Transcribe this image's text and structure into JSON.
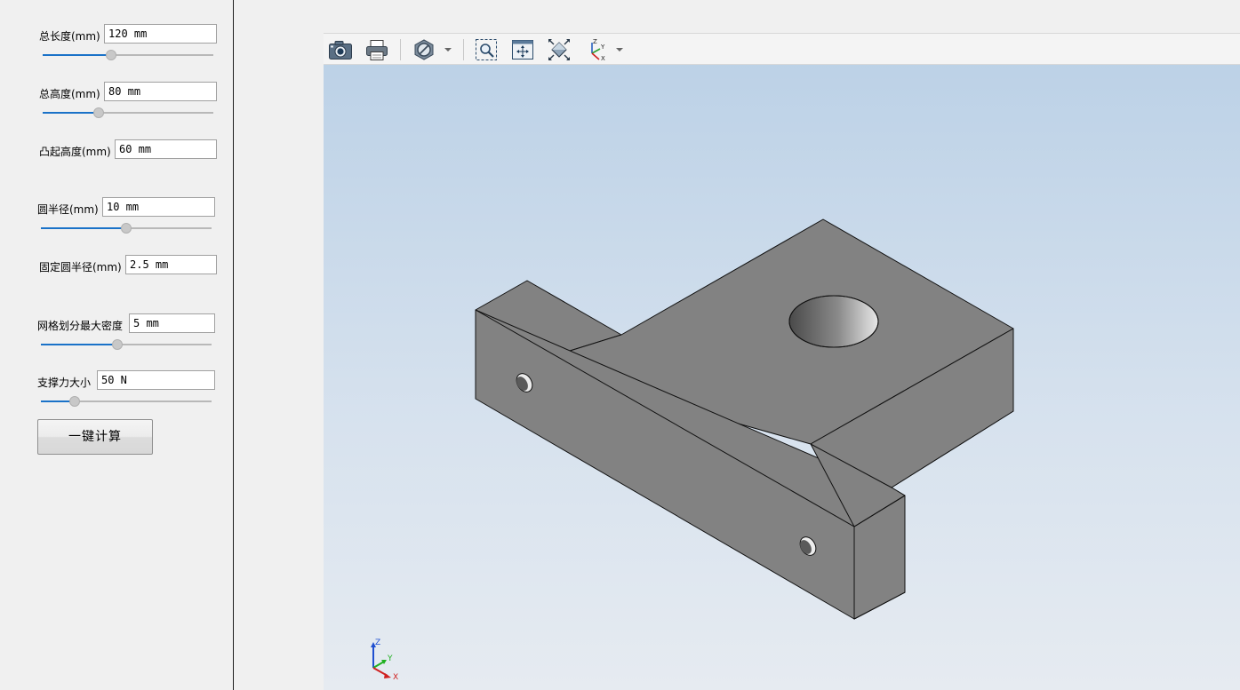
{
  "params": [
    {
      "label": "总长度(mm)",
      "value": "120 mm",
      "slider": 0.4
    },
    {
      "label": "总高度(mm)",
      "value": "80 mm",
      "slider": 0.33
    },
    {
      "label": "凸起高度(mm)",
      "value": "60 mm"
    },
    {
      "label": "圆半径(mm)",
      "value": "10 mm",
      "slider": 0.5
    },
    {
      "label": "固定圆半径(mm)",
      "value": "2.5 mm"
    },
    {
      "label": "网格划分最大密度",
      "value": "5 mm",
      "slider": 0.45
    },
    {
      "label": "支撑力大小",
      "value": "50 N",
      "slider": 0.2
    }
  ],
  "calc_button": "一键计算",
  "toolbar": {
    "icons": [
      "camera-icon",
      "print-icon",
      "display-mode-icon",
      "zoom-window-icon",
      "fit-all-icon",
      "view-cube-icon",
      "axes-orientation-icon"
    ]
  },
  "triad": {
    "z": "Z",
    "y": "Y",
    "x": "X"
  },
  "axes_icon": {
    "z": "Z",
    "y": "Y",
    "x": "X"
  },
  "colors": {
    "accent": "#1a72c8",
    "model_face": "#828282",
    "model_edge": "#111111",
    "viewer_top": "#bad0e6",
    "viewer_bottom": "#e6ebf1"
  }
}
